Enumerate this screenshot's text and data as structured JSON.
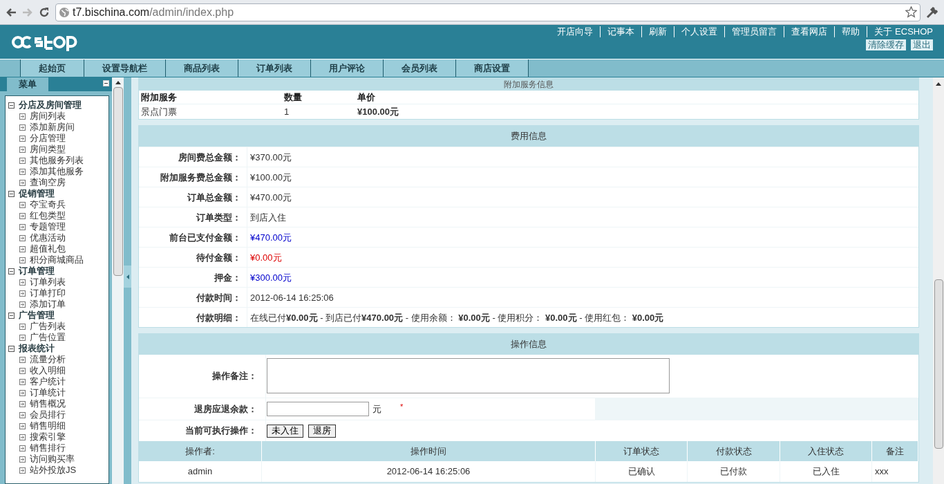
{
  "browser": {
    "url_host": "t7.bischina.com",
    "url_path": "/admin/index.php"
  },
  "header": {
    "links": [
      "开店向导",
      "记事本",
      "刷新",
      "个人设置",
      "管理员留言",
      "查看网店",
      "帮助",
      "关于 ECSHOP"
    ],
    "buttons": [
      "清除缓存",
      "退出"
    ]
  },
  "nav": [
    "起始页",
    "设置导航栏",
    "商品列表",
    "订单列表",
    "用户评论",
    "会员列表",
    "商店设置"
  ],
  "sidebar": {
    "title": "菜单",
    "groups": [
      {
        "label": "分店及房间管理",
        "expanded": true,
        "children": [
          "房间列表",
          "添加新房间",
          "分店管理",
          "房间类型",
          "其他服务列表",
          "添加其他服务",
          "查询空房"
        ]
      },
      {
        "label": "促销管理",
        "expanded": true,
        "children": [
          "夺宝奇兵",
          "红包类型",
          "专题管理",
          "优惠活动",
          "超值礼包",
          "积分商城商品"
        ]
      },
      {
        "label": "订单管理",
        "expanded": true,
        "children": [
          "订单列表",
          "订单打印",
          "添加订单"
        ]
      },
      {
        "label": "广告管理",
        "expanded": true,
        "children": [
          "广告列表",
          "广告位置"
        ]
      },
      {
        "label": "报表统计",
        "expanded": true,
        "children": [
          "流量分析",
          "收入明细",
          "客户统计",
          "订单统计",
          "销售概况",
          "会员排行",
          "销售明细",
          "搜索引擎",
          "销售排行",
          "访问购买率",
          "站外投放JS"
        ]
      }
    ]
  },
  "services": {
    "title": "附加服务信息",
    "columns": [
      "附加服务",
      "数量",
      "单价"
    ],
    "rows": [
      [
        "景点门票",
        "1",
        "¥100.00元"
      ]
    ]
  },
  "fees": {
    "title": "费用信息",
    "rows": [
      {
        "label": "房间费总金额：",
        "value": "¥370.00元",
        "color": "#333333"
      },
      {
        "label": "附加服务费总金额：",
        "value": "¥100.00元",
        "color": "#333333"
      },
      {
        "label": "订单总金额：",
        "value": "¥470.00元",
        "color": "#333333"
      },
      {
        "label": "订单类型：",
        "value": "到店入住",
        "color": "#333333"
      },
      {
        "label": "前台已支付金额：",
        "value": "¥470.00元",
        "color": "#0000cc"
      },
      {
        "label": "待付金额：",
        "value": "¥0.00元",
        "color": "#dd0000"
      },
      {
        "label": "押金：",
        "value": "¥300.00元",
        "color": "#0000cc"
      },
      {
        "label": "付款时间：",
        "value": "2012-06-14 16:25:06",
        "color": "#333333"
      },
      {
        "label": "付款明细：",
        "value": "在线已付**¥0.00元** - 到店已付**¥470.00元** - 使用余额： **¥0.00元** - 使用积分： **¥0.00元** - 使用红包： **¥0.00元**",
        "color": "#333333"
      }
    ]
  },
  "operation": {
    "title": "操作信息",
    "note_label": "操作备注：",
    "refund_label": "退房应退余款：",
    "refund_unit": "元",
    "required_mark": "*",
    "actions_label": "当前可执行操作：",
    "actions": [
      "未入住",
      "退房"
    ],
    "log_columns": [
      "操作者:",
      "操作时间",
      "订单状态",
      "付款状态",
      "入住状态",
      "备注"
    ],
    "log_rows": [
      [
        "admin",
        "2012-06-14 16:25:06",
        "已确认",
        "已付款",
        "已入住",
        "xxx"
      ]
    ]
  }
}
